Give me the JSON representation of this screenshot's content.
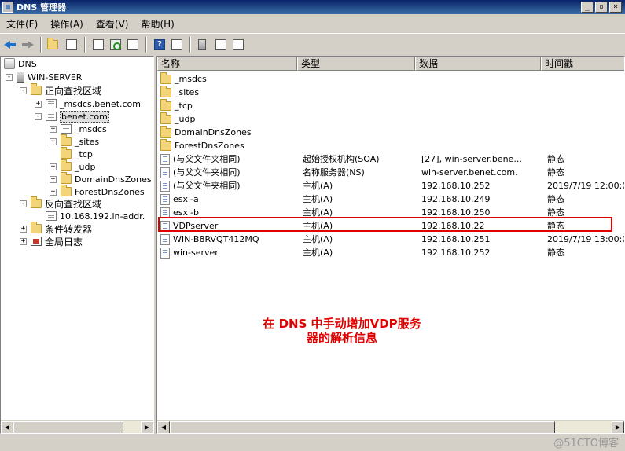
{
  "window": {
    "title": "DNS 管理器"
  },
  "menu": [
    "文件(F)",
    "操作(A)",
    "查看(V)",
    "帮助(H)"
  ],
  "tree": {
    "root": "DNS",
    "server": "WIN-SERVER",
    "forward_zones": "正向查找区域",
    "msdcs_zone": "_msdcs.benet.com",
    "benet_zone": "benet.com",
    "benet_children": [
      "_msdcs",
      "_sites",
      "_tcp",
      "_udp",
      "DomainDnsZones",
      "ForestDnsZones"
    ],
    "reverse_zones": "反向查找区域",
    "reverse_zone": "10.168.192.in-addr.",
    "conditional_forwarders": "条件转发器",
    "global_logs": "全局日志"
  },
  "list": {
    "headers": {
      "name": "名称",
      "type": "类型",
      "data": "数据",
      "timestamp": "时间戳"
    },
    "rows": [
      {
        "name": "_msdcs",
        "type": "",
        "data": "",
        "timestamp": "",
        "icon": "folder-icon"
      },
      {
        "name": "_sites",
        "type": "",
        "data": "",
        "timestamp": "",
        "icon": "folder-icon"
      },
      {
        "name": "_tcp",
        "type": "",
        "data": "",
        "timestamp": "",
        "icon": "folder-icon"
      },
      {
        "name": "_udp",
        "type": "",
        "data": "",
        "timestamp": "",
        "icon": "folder-icon"
      },
      {
        "name": "DomainDnsZones",
        "type": "",
        "data": "",
        "timestamp": "",
        "icon": "folder-icon"
      },
      {
        "name": "ForestDnsZones",
        "type": "",
        "data": "",
        "timestamp": "",
        "icon": "folder-icon"
      },
      {
        "name": "(与父文件夹相同)",
        "type": "起始授权机构(SOA)",
        "data": "[27], win-server.bene...",
        "timestamp": "静态",
        "icon": "record-icon"
      },
      {
        "name": "(与父文件夹相同)",
        "type": "名称服务器(NS)",
        "data": "win-server.benet.com.",
        "timestamp": "静态",
        "icon": "record-icon"
      },
      {
        "name": "(与父文件夹相同)",
        "type": "主机(A)",
        "data": "192.168.10.252",
        "timestamp": "2019/7/19 12:00:0",
        "icon": "record-icon"
      },
      {
        "name": "esxi-a",
        "type": "主机(A)",
        "data": "192.168.10.249",
        "timestamp": "静态",
        "icon": "record-icon"
      },
      {
        "name": "esxi-b",
        "type": "主机(A)",
        "data": "192.168.10.250",
        "timestamp": "静态",
        "icon": "record-icon"
      },
      {
        "name": "VDPserver",
        "type": "主机(A)",
        "data": "192.168.10.22",
        "timestamp": "静态",
        "icon": "record-icon"
      },
      {
        "name": "WIN-B8RVQT412MQ",
        "type": "主机(A)",
        "data": "192.168.10.251",
        "timestamp": "2019/7/19 13:00:0",
        "icon": "record-icon"
      },
      {
        "name": "win-server",
        "type": "主机(A)",
        "data": "192.168.10.252",
        "timestamp": "静态",
        "icon": "record-icon"
      }
    ]
  },
  "annotation": {
    "line1": "在 DNS 中手动增加VDP服务",
    "line2": "器的解析信息"
  },
  "watermark": "@51CTO博客",
  "colors": {
    "annotation": "#e00000",
    "highlight": "#e00000",
    "titlebar": "#0a246a"
  }
}
